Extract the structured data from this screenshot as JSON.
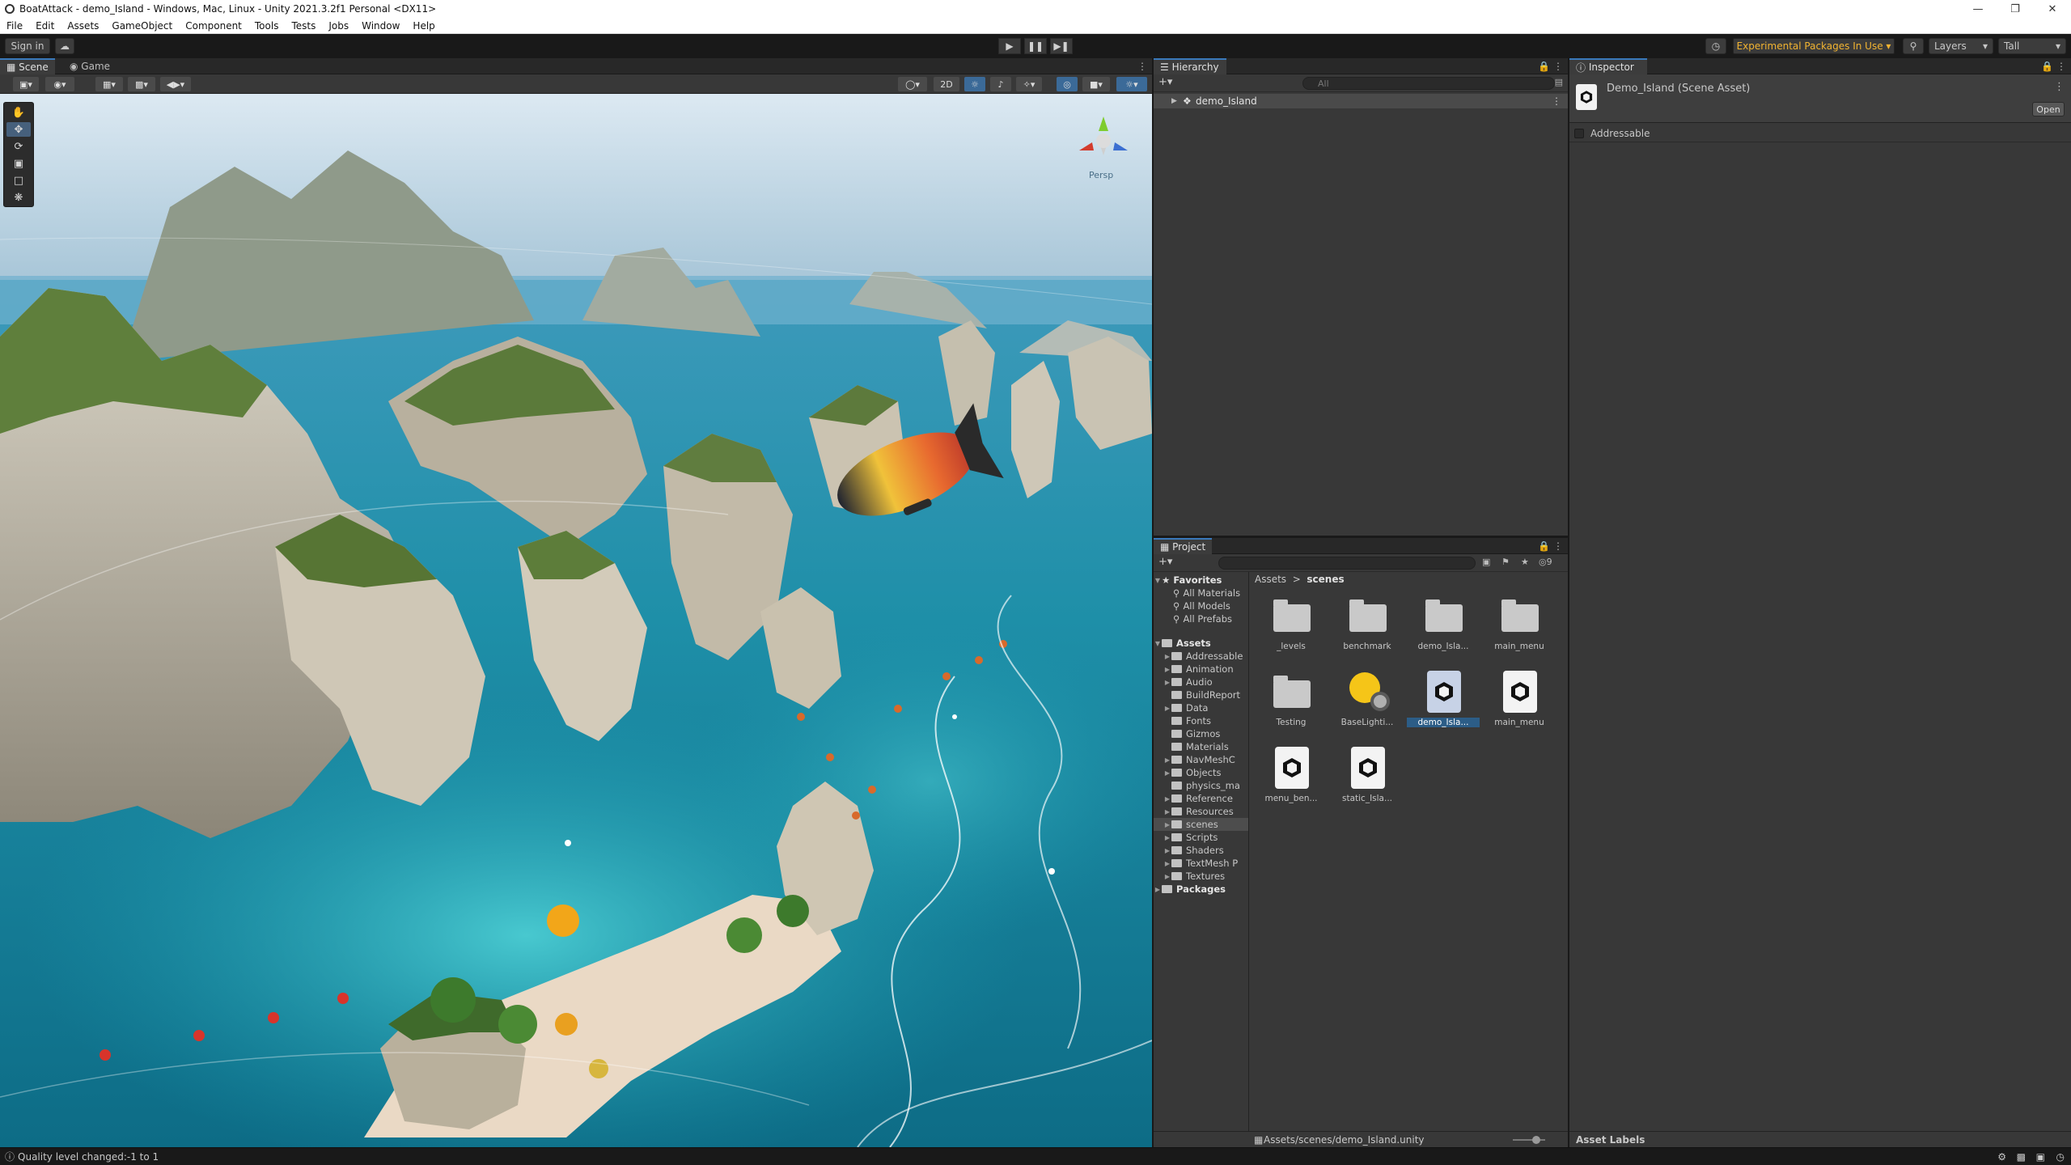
{
  "window": {
    "title": "BoatAttack - demo_Island - Windows, Mac, Linux - Unity 2021.3.2f1 Personal <DX11>",
    "controls": [
      "minimize",
      "restore",
      "close"
    ]
  },
  "menu": [
    "File",
    "Edit",
    "Assets",
    "GameObject",
    "Component",
    "Tools",
    "Tests",
    "Jobs",
    "Window",
    "Help"
  ],
  "toolbar": {
    "sign_in": "Sign in",
    "experimental": "Experimental Packages In Use",
    "layers": "Layers",
    "layout": "Tall",
    "experimental_color": "#f2b431"
  },
  "scene": {
    "tabs": [
      "Scene",
      "Game"
    ],
    "mode_2d": "2D",
    "persp": "Persp",
    "tools": [
      "hand-icon",
      "move-icon",
      "rotate-icon",
      "scale-icon",
      "rect-icon",
      "transform-icon"
    ]
  },
  "hierarchy": {
    "tab": "Hierarchy",
    "search_placeholder": "All",
    "root": "demo_Island"
  },
  "project": {
    "tab": "Project",
    "favorites_label": "Favorites",
    "favorites": [
      "All Materials",
      "All Models",
      "All Prefabs"
    ],
    "assets_label": "Assets",
    "folders": [
      "Addressable",
      "Animation",
      "Audio",
      "BuildReport",
      "Data",
      "Fonts",
      "Gizmos",
      "Materials",
      "NavMeshC",
      "Objects",
      "physics_ma",
      "Reference",
      "Resources",
      "scenes",
      "Scripts",
      "Shaders",
      "TextMesh P",
      "Textures"
    ],
    "packages_label": "Packages",
    "breadcrumb": [
      "Assets",
      "scenes"
    ],
    "items": [
      {
        "name": "_levels",
        "kind": "folder"
      },
      {
        "name": "benchmark",
        "kind": "folder"
      },
      {
        "name": "demo_Isla...",
        "kind": "folder"
      },
      {
        "name": "main_menu",
        "kind": "folder"
      },
      {
        "name": "Testing",
        "kind": "folder"
      },
      {
        "name": "BaseLighti...",
        "kind": "lighting"
      },
      {
        "name": "demo_Isla...",
        "kind": "scene"
      },
      {
        "name": "main_menu",
        "kind": "scene"
      },
      {
        "name": "menu_ben...",
        "kind": "scene"
      },
      {
        "name": "static_Isla...",
        "kind": "scene"
      }
    ],
    "path": "Assets/scenes/demo_Island.unity",
    "icon_count": "9"
  },
  "inspector": {
    "tab": "Inspector",
    "title": "Demo_Island (Scene Asset)",
    "open": "Open",
    "addressable": "Addressable",
    "asset_labels": "Asset Labels"
  },
  "status": {
    "message": "Quality level changed:-1 to 1"
  }
}
